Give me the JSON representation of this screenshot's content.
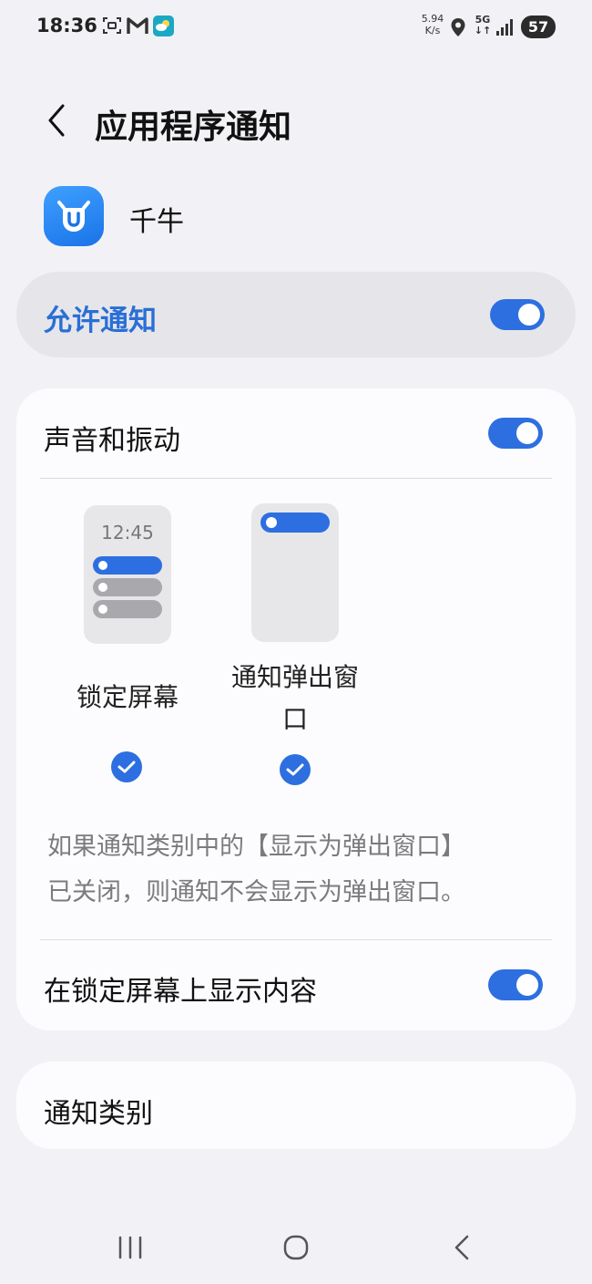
{
  "status_bar": {
    "time": "18:36",
    "net_speed_value": "5.94",
    "net_speed_unit": "K/s",
    "network": "5G",
    "battery": "57",
    "icons": [
      "screenshot-icon",
      "gmail-icon",
      "weather-icon",
      "location-icon",
      "signal-icon"
    ]
  },
  "header": {
    "title": "应用程序通知"
  },
  "app": {
    "name": "千牛",
    "icon": "qianniu-app-icon",
    "icon_color": "#1a73e8"
  },
  "allow": {
    "label": "允许通知",
    "enabled": true
  },
  "settings": {
    "sound_label": "声音和振动",
    "sound_enabled": true,
    "lock_screen_preview_time": "12:45",
    "lock_screen_label": "锁定屏幕",
    "lock_screen_checked": true,
    "popup_label_line1": "通知弹出窗",
    "popup_label_line2": "口",
    "popup_checked": true,
    "info_line1": "如果通知类别中的【显示为弹出窗口】",
    "info_line2": "已关闭，则通知不会显示为弹出窗口。",
    "show_content_label": "在锁定屏幕上显示内容",
    "show_content_enabled": true
  },
  "categories": {
    "label": "通知类别"
  },
  "colors": {
    "accent": "#2d6fe0",
    "allow_label": "#2a6fd6",
    "background": "#f2f2f6",
    "card": "#fcfcfe"
  },
  "nav": {
    "icons": [
      "recent-apps-icon",
      "home-icon",
      "back-icon"
    ]
  }
}
